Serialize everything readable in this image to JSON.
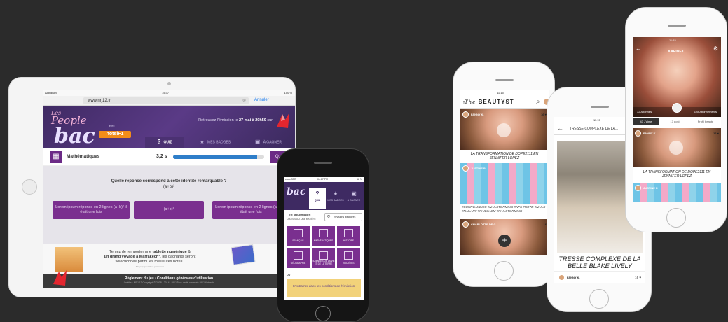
{
  "ipad": {
    "status": {
      "left": "Appldium",
      "time": "15:37",
      "right": "100 %"
    },
    "url": "www.nrj12.fr",
    "cancel": "Annuler",
    "logo": {
      "les": "Les",
      "people": "People",
      "bac": "bac",
      "avec": "avec",
      "hotel": "hotelF1"
    },
    "emission": {
      "pre": "Retrouvez l'émission le ",
      "date": "27 mai à 20h50",
      "post": " sur"
    },
    "tabs": [
      {
        "label": "QUIZ",
        "icon": "?"
      },
      {
        "label": "MES BADGES",
        "icon": "★"
      },
      {
        "label": "À GAGNER",
        "icon": "▣"
      }
    ],
    "subject": "Mathématiques",
    "timer": "3,2 s",
    "progress": 0.92,
    "question_badge": "Q.",
    "question": "Quelle réponse correspond à cette identité remarquable ?",
    "formula": "(a+b)²",
    "answers": [
      "Lorem ipsum réponse en 2 lignes (a+b)² il était une fois",
      "(a+b)²",
      "Lorem ipsum réponse en 2 lignes (a+b)² il était une fois"
    ],
    "promo": {
      "l1_pre": "Tentez de remporter une ",
      "l1_bold": "tablette numérique",
      "l1_post": " &",
      "l2_bold": "un grand voyage à Marrakech",
      "l2_post": "*, les gagnants seront",
      "l3": "sélectionnés parmi les meilleures notes !",
      "l4": "*Voyage pour deux personnes"
    },
    "footer": {
      "links": "Règlement du jeu · Conditions générales d'utilisation",
      "copy": "Crédits : NRJ 12 Copyright © 2008 - 2014 - NRJ Tous droits réservés NRJ Network"
    },
    "nrj": "nrj"
  },
  "dark_phone": {
    "status": {
      "left": "•••oo SFR",
      "time": "04:17 PM",
      "right": "66 %"
    },
    "url": "google.fr",
    "bac": "bac",
    "tabs": [
      {
        "label": "QUIZ",
        "icon": "?"
      },
      {
        "label": "MES BADGES",
        "icon": "★"
      },
      {
        "label": "À GAGNER",
        "icon": "▣"
      }
    ],
    "rev_title": "LES RÉVISIONS",
    "rev_sub": "CHOISISSEZ UNE MATIÈRE",
    "rev_btn": "Révisions aléatoires",
    "tiles": [
      "FRANÇAIS",
      "MATHÉMATIQUES",
      "HISTOIRE",
      "GÉOGRAPHIE",
      "SCIENCES DE LA VIE ET DE LA TERRE",
      "SOCIÉTÉS"
    ],
    "ou": "OU",
    "cta": "S'entraîner dans les conditions de l'émission"
  },
  "beautyst_phone": {
    "time": "11:15",
    "logo_the": "The",
    "logo": "BEAUTYST",
    "post1": {
      "user": "FANNY K.",
      "likes": "16 ♥",
      "caption": "LA TRANSFORMATION DE DOPE2111 EN JENNIFER LOPEZ"
    },
    "post2": {
      "user": "JUSTINE P.",
      "hashtags": "#SOURCANDIES #NAILSTORMING #NPA #NOTD #NAILS #NAILART #NAILGASM #NAILSTORMING"
    },
    "post3": {
      "user": "CHARLOTTE DE C.",
      "likes": "16"
    },
    "fab": "+"
  },
  "blake_phone": {
    "time": "11:15",
    "title": "TRESSE COMPLEXE DE LA...",
    "caption": "TRESSE COMPLEXE DE LA BELLE BLAKE LIVELY",
    "user": "FANNY K.",
    "likes": "16 ♥"
  },
  "karine_phone": {
    "time": "11:15",
    "name": "KARINE L.",
    "followers": "32 Abonnés",
    "following": "128 Abonnements",
    "tabs": [
      "43 J'aime",
      "17 post",
      "Profil beauté"
    ],
    "post": {
      "user": "FANNY K.",
      "likes": "16 ♥",
      "caption": "LA TRANSFORMATION DE DOPE2111 EN JENNIFER LOPEZ"
    },
    "post2_user": "JUSTINE P."
  },
  "colors": {
    "background": "#2b2b2b",
    "purple": "#5a3a86",
    "tile": "#7a2f8f",
    "accent_blue": "#2e7ec9",
    "yellow": "#f2d27a"
  }
}
